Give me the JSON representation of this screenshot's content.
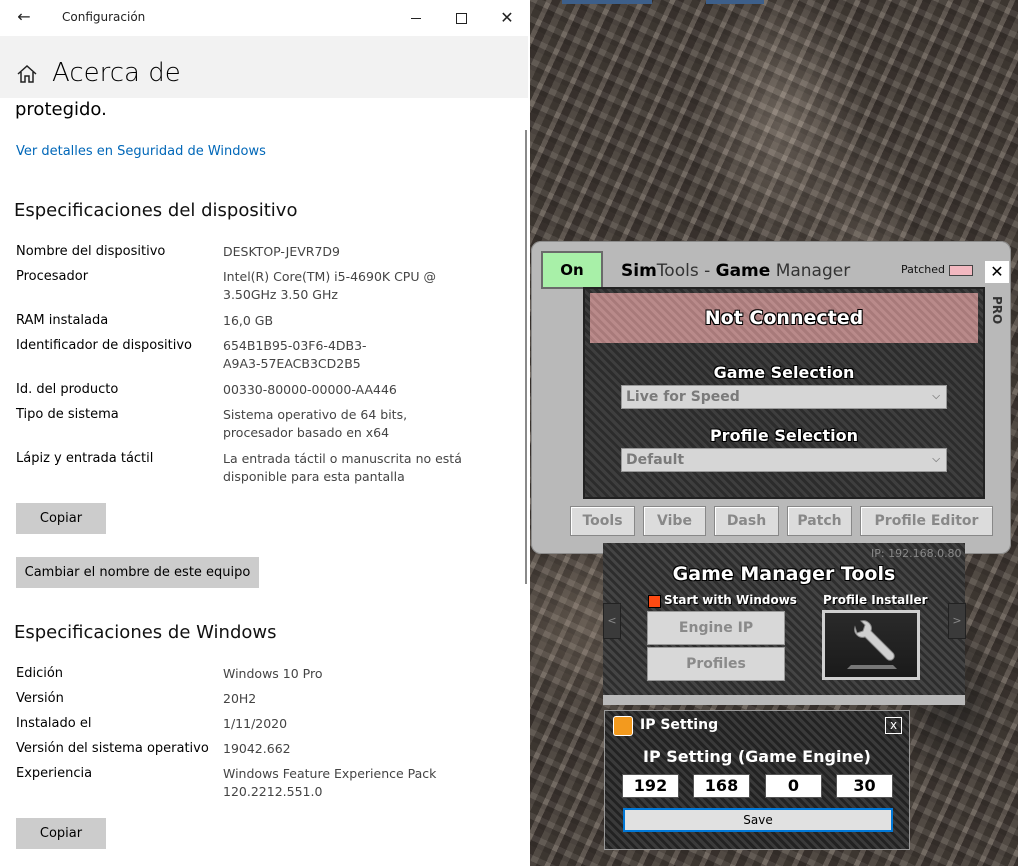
{
  "window": {
    "app_title": "Configuración",
    "page_title": "Acerca de"
  },
  "security": {
    "tail_text": "protegido.",
    "link": "Ver detalles en Seguridad de Windows"
  },
  "device_specs": {
    "heading": "Especificaciones del dispositivo",
    "rows": [
      {
        "label": "Nombre del dispositivo",
        "value": "DESKTOP-JEVR7D9"
      },
      {
        "label": "Procesador",
        "value": "Intel(R) Core(TM) i5-4690K CPU @ 3.50GHz   3.50 GHz"
      },
      {
        "label": "RAM instalada",
        "value": "16,0 GB"
      },
      {
        "label": "Identificador de dispositivo",
        "value": "654B1B95-03F6-4DB3-A9A3-57EACB3CD2B5"
      },
      {
        "label": "Id. del producto",
        "value": "00330-80000-00000-AA446"
      },
      {
        "label": "Tipo de sistema",
        "value": "Sistema operativo de 64 bits, procesador basado en x64"
      },
      {
        "label": "Lápiz y entrada táctil",
        "value": "La entrada táctil o manuscrita no está disponible para esta pantalla"
      }
    ],
    "copy_button": "Copiar",
    "rename_button": "Cambiar el nombre de este equipo"
  },
  "windows_specs": {
    "heading": "Especificaciones de Windows",
    "rows": [
      {
        "label": "Edición",
        "value": "Windows 10 Pro"
      },
      {
        "label": "Versión",
        "value": "20H2"
      },
      {
        "label": "Instalado el",
        "value": "1/11/2020"
      },
      {
        "label": "Versión del sistema operativo",
        "value": "19042.662"
      },
      {
        "label": "Experiencia",
        "value": "Windows Feature Experience Pack 120.2212.551.0"
      }
    ],
    "copy_button": "Copiar"
  },
  "simtools": {
    "on_button": "On",
    "title_sim": "Sim",
    "title_tools": "Tools - ",
    "title_game": "Game",
    "title_manager": " Manager",
    "patched_label": "Patched",
    "close": "✕",
    "pro_tab": "PRO",
    "status": "Not Connected",
    "game_selection_label": "Game Selection",
    "game_selection_value": "Live for Speed",
    "profile_selection_label": "Profile Selection",
    "profile_selection_value": "Default",
    "tabs": [
      "Tools",
      "Vibe",
      "Dash",
      "Patch",
      "Profile Editor"
    ],
    "colors": {
      "on": "#a8f0a8",
      "status_bg": "#b98a8a",
      "checkbox": "#ff4a12"
    }
  },
  "gm_tools": {
    "ip_caption": "IP: 192.168.0.80",
    "title": "Game Manager Tools",
    "start_with_windows": "Start with Windows",
    "profile_installer": "Profile Installer",
    "engine_ip_button": "Engine IP",
    "profiles_button": "Profiles",
    "left_arrow": "<",
    "right_arrow": ">"
  },
  "ip_dialog": {
    "title": "IP Setting",
    "close": "x",
    "heading": "IP Setting (Game Engine)",
    "octets": [
      "192",
      "168",
      "0",
      "30"
    ],
    "save_button": "Save"
  }
}
